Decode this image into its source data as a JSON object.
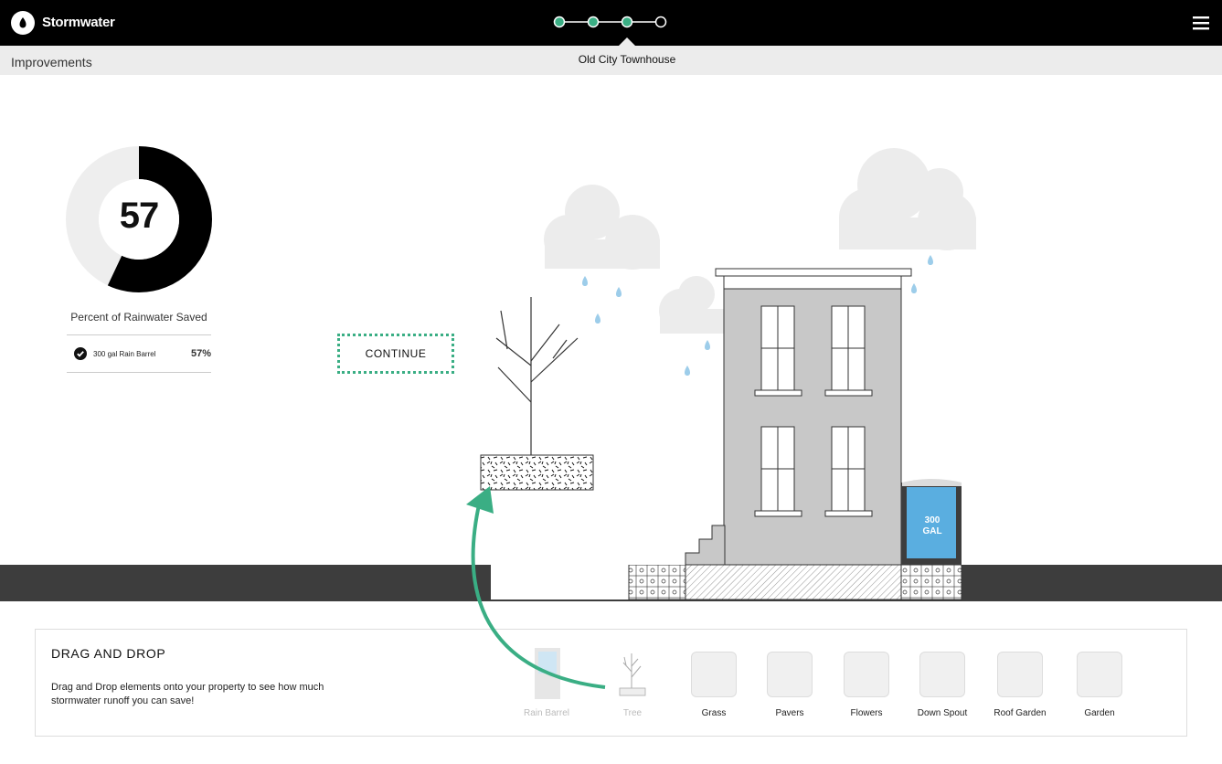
{
  "app": {
    "title": "Stormwater"
  },
  "header": {
    "menu_icon": "hamburger-menu-icon",
    "steps_total": 4,
    "steps_completed": 3
  },
  "subheader": {
    "section": "Improvements",
    "property_name": "Old City Townhouse"
  },
  "score": {
    "value": "57",
    "fraction": 0.57,
    "label": "Percent of Rainwater Saved",
    "items": [
      {
        "name": "300 gal Rain Barrel",
        "percent": "57%",
        "icon": "checkmark-icon"
      }
    ]
  },
  "actions": {
    "continue_label": "CONTINUE"
  },
  "scene": {
    "barrel_label_line1": "300",
    "barrel_label_line2": "GAL"
  },
  "drag_drop": {
    "title": "DRAG AND DROP",
    "description": "Drag and Drop elements onto your property to see how much stormwater runoff you can save!",
    "tools": [
      {
        "label": "Rain Barrel",
        "used": true
      },
      {
        "label": "Tree",
        "used": true
      },
      {
        "label": "Grass",
        "used": false
      },
      {
        "label": "Pavers",
        "used": false
      },
      {
        "label": "Flowers",
        "used": false
      },
      {
        "label": "Down Spout",
        "used": false
      },
      {
        "label": "Roof Garden",
        "used": false
      },
      {
        "label": "Garden",
        "used": false
      }
    ]
  },
  "colors": {
    "accent": "#3aae84",
    "water": "#5aaee0",
    "drop": "#9dcdea",
    "building": "#c8c8c8",
    "ground": "#3d3d3d",
    "cloud": "#ececec"
  }
}
